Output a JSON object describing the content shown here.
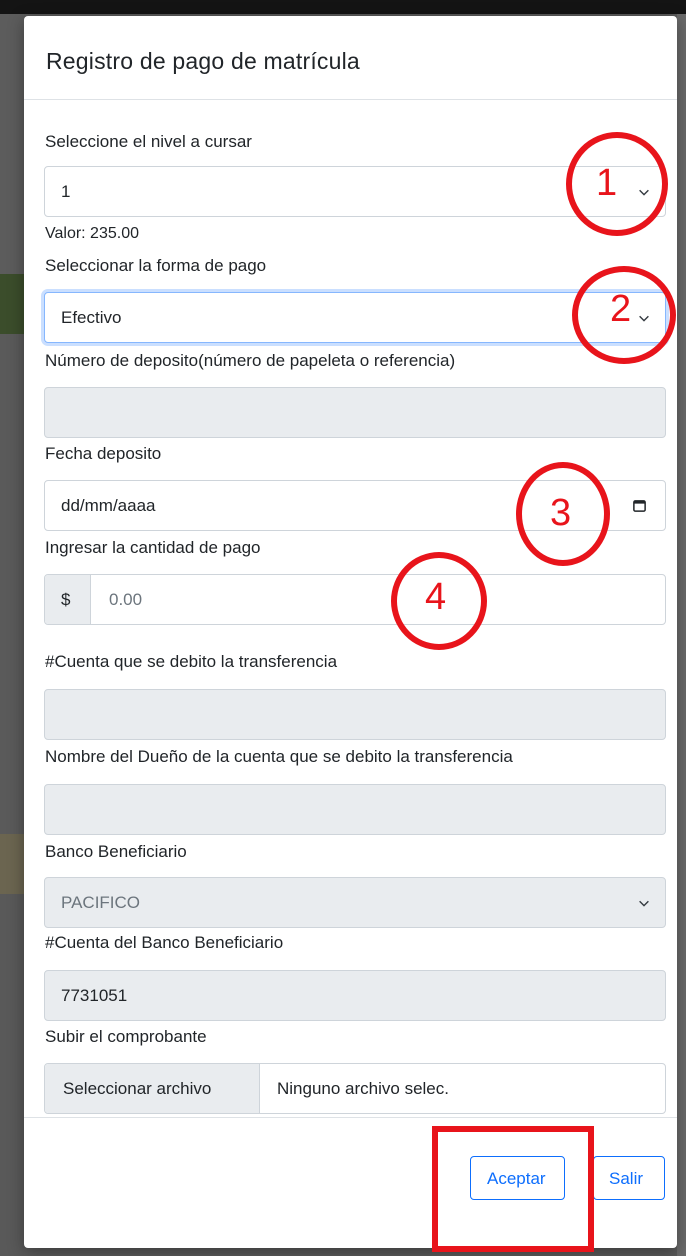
{
  "modal": {
    "title": "Registro de pago de matrícula"
  },
  "form": {
    "nivel": {
      "label": "Seleccione el nivel a cursar",
      "value": "1",
      "valor_text": "Valor: 235.00"
    },
    "forma_pago": {
      "label": "Seleccionar la forma de pago",
      "value": "Efectivo"
    },
    "numero_deposito": {
      "label": "Número de deposito(número de papeleta o referencia)",
      "value": ""
    },
    "fecha_deposito": {
      "label": "Fecha deposito",
      "placeholder": "dd/mm/aaaa"
    },
    "cantidad_pago": {
      "label": "Ingresar la cantidad de pago",
      "prefix": "$",
      "placeholder": "0.00"
    },
    "cuenta_debito": {
      "label": "#Cuenta que se debito la transferencia",
      "value": ""
    },
    "dueno_cuenta": {
      "label": "Nombre del Dueño de la cuenta que se debito la transferencia",
      "value": ""
    },
    "banco_beneficiario": {
      "label": "Banco Beneficiario",
      "value": "PACIFICO"
    },
    "cuenta_beneficiario": {
      "label": "#Cuenta del Banco Beneficiario",
      "value": "7731051"
    },
    "comprobante": {
      "label": "Subir el comprobante",
      "button_label": "Seleccionar archivo",
      "file_status": "Ninguno archivo selec."
    }
  },
  "footer": {
    "accept_label": "Aceptar",
    "exit_label": "Salir"
  },
  "annotations": {
    "markers": [
      "1",
      "2",
      "3",
      "4"
    ],
    "color": "#e8141b"
  },
  "colors": {
    "primary": "#0d6efd",
    "disabled_bg": "#e9ecef",
    "border": "#ced4da"
  }
}
